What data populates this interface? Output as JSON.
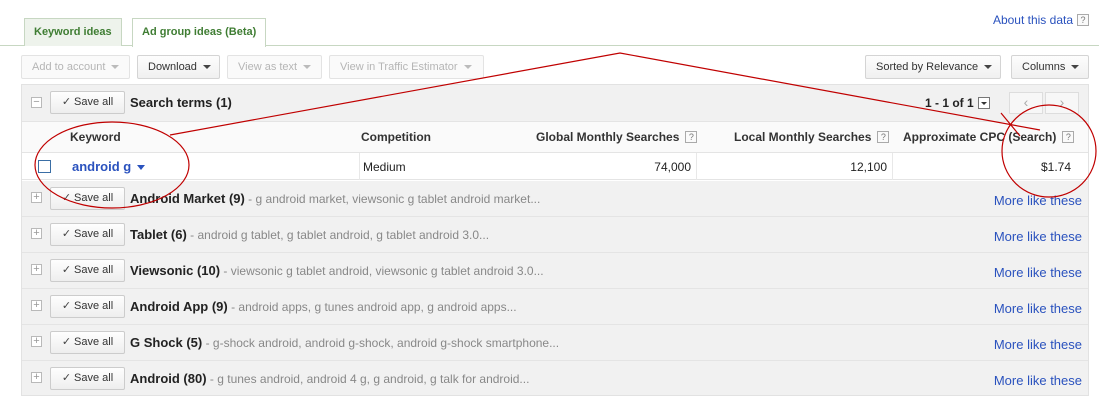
{
  "tabs": [
    {
      "label": "Keyword ideas",
      "active": false
    },
    {
      "label": "Ad group ideas (Beta)",
      "active": true
    }
  ],
  "about": {
    "label": "About this data",
    "help": "?"
  },
  "toolbar": {
    "add_to_account": "Add to account",
    "download": "Download",
    "view_as_text": "View as text",
    "view_in_traffic_estimator": "View in Traffic Estimator",
    "sort": "Sorted by Relevance",
    "columns": "Columns"
  },
  "search_terms": {
    "save_all": "Save all",
    "title": "Search terms (1)",
    "pagination": "1 - 1 of 1",
    "prev": "‹",
    "next": "›"
  },
  "columns": {
    "keyword": "Keyword",
    "competition": "Competition",
    "global": "Global Monthly Searches",
    "local": "Local Monthly Searches",
    "cpc": "Approximate CPC (Search)",
    "help": "?"
  },
  "keyword_row": {
    "keyword": "android g",
    "competition": "Medium",
    "global": "74,000",
    "local": "12,100",
    "cpc": "$1.74"
  },
  "groups": [
    {
      "name": "Android Market (9)",
      "desc": " - g android market, viewsonic g tablet android market...",
      "save": "Save all",
      "more": "More like these"
    },
    {
      "name": "Tablet (6)",
      "desc": " - android g tablet, g tablet android, g tablet android 3.0...",
      "save": "Save all",
      "more": "More like these"
    },
    {
      "name": "Viewsonic (10)",
      "desc": " - viewsonic g tablet android, viewsonic g tablet android 3.0...",
      "save": "Save all",
      "more": "More like these"
    },
    {
      "name": "Android App (9)",
      "desc": " - android apps, g tunes android app, g android apps...",
      "save": "Save all",
      "more": "More like these"
    },
    {
      "name": "G Shock (5)",
      "desc": " - g-shock android, android g-shock, android g-shock smartphone...",
      "save": "Save all",
      "more": "More like these"
    },
    {
      "name": "Android (80)",
      "desc": " - g tunes android, android 4 g, g android, g talk for android...",
      "save": "Save all",
      "more": "More like these"
    }
  ],
  "colors": {
    "annotation": "#c00000",
    "link": "#2a52be",
    "tab_text": "#3f7d33"
  }
}
